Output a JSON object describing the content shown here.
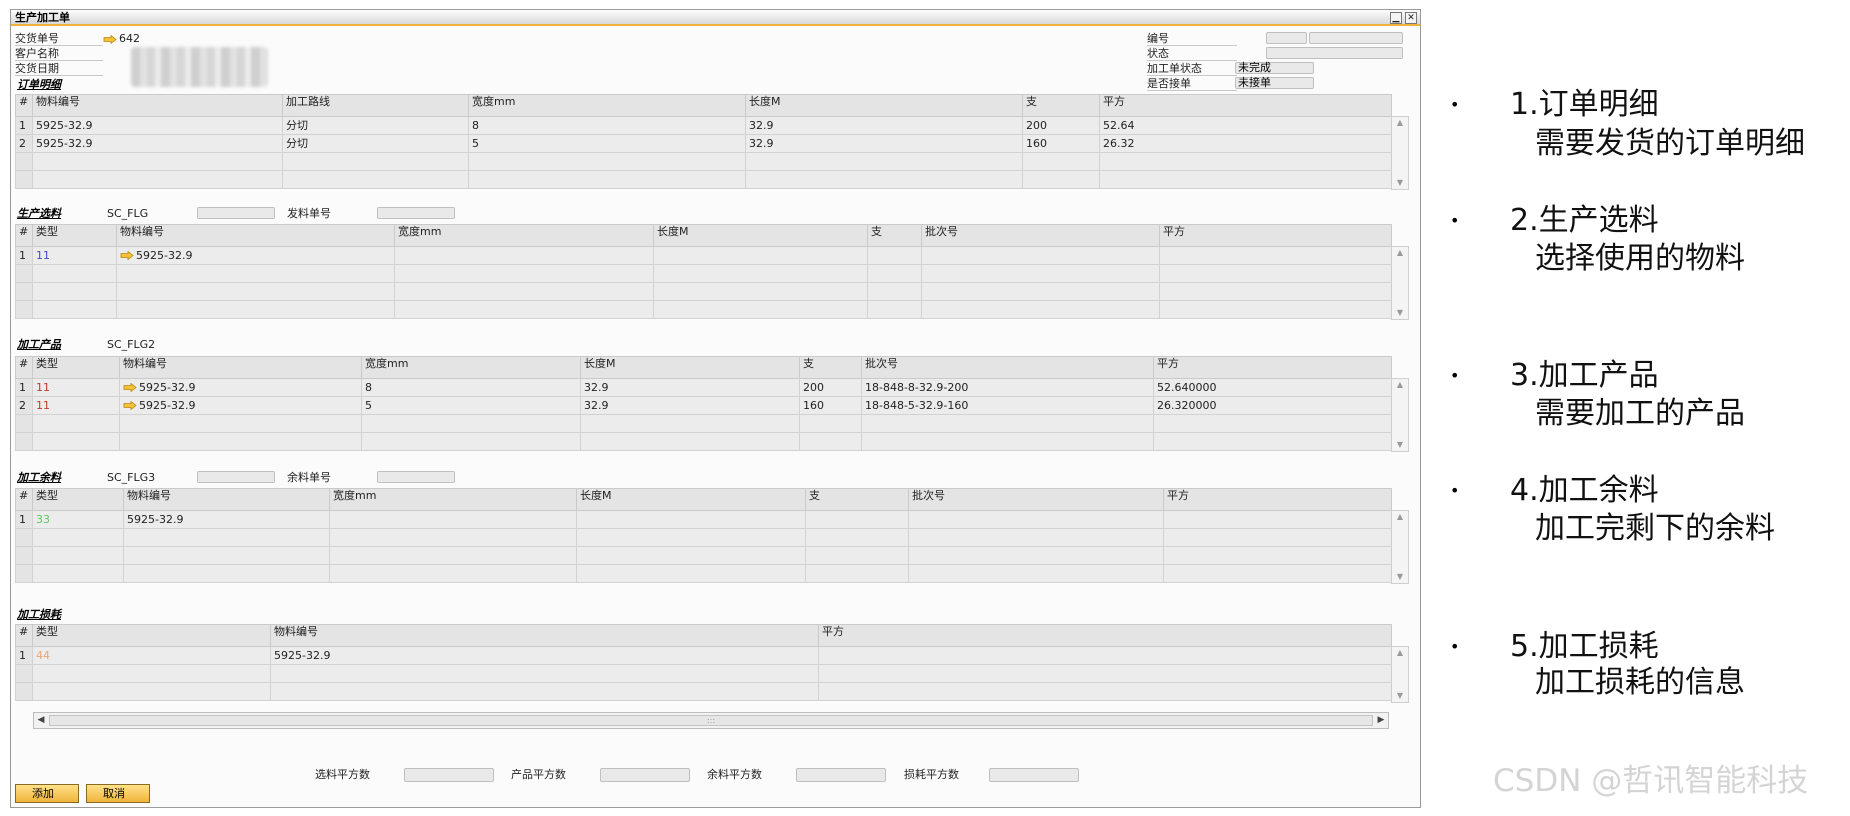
{
  "window": {
    "title": "生产加工单",
    "minimize_glyph": "▁",
    "close_glyph": "✕"
  },
  "header": {
    "delivery_no_label": "交货单号",
    "delivery_no_value": "642",
    "customer_label": "客户名称",
    "delivery_date_label": "交货日期",
    "code_label": "编号",
    "status_label": "状态",
    "process_status_label": "加工单状态",
    "process_status_value": "未完成",
    "is_accepted_label": "是否接单",
    "is_accepted_value": "未接单"
  },
  "order_detail": {
    "title": "订单明细",
    "headers": [
      "#",
      "物料编号",
      "加工路线",
      "宽度mm",
      "长度M",
      "支",
      "平方"
    ],
    "rows": [
      [
        "1",
        "5925-32.9",
        "分切",
        "8",
        "32.9",
        "200",
        "52.64"
      ],
      [
        "2",
        "5925-32.9",
        "分切",
        "5",
        "32.9",
        "160",
        "26.32"
      ]
    ]
  },
  "material_select": {
    "title": "生产选料",
    "flag": "SC_FLG",
    "issue_no_label": "发料单号",
    "headers": [
      "#",
      "类型",
      "物料编号",
      "宽度mm",
      "长度M",
      "支",
      "批次号",
      "平方"
    ],
    "rows": [
      [
        "1",
        "11",
        "5925-32.9",
        "",
        "",
        "",
        "",
        ""
      ]
    ]
  },
  "process_product": {
    "title": "加工产品",
    "flag": "SC_FLG2",
    "headers": [
      "#",
      "类型",
      "物料编号",
      "宽度mm",
      "长度M",
      "支",
      "批次号",
      "平方"
    ],
    "rows": [
      [
        "1",
        "11",
        "5925-32.9",
        "8",
        "32.9",
        "200",
        "18-848-8-32.9-200",
        "52.640000"
      ],
      [
        "2",
        "11",
        "5925-32.9",
        "5",
        "32.9",
        "160",
        "18-848-5-32.9-160",
        "26.320000"
      ]
    ]
  },
  "process_remainder": {
    "title": "加工余料",
    "flag": "SC_FLG3",
    "remainder_no_label": "余料单号",
    "headers": [
      "#",
      "类型",
      "物料编号",
      "宽度mm",
      "长度M",
      "支",
      "批次号",
      "平方"
    ],
    "rows": [
      [
        "1",
        "33",
        "5925-32.9",
        "",
        "",
        "",
        "",
        ""
      ]
    ]
  },
  "process_loss": {
    "title": "加工损耗",
    "headers": [
      "#",
      "类型",
      "物料编号",
      "平方"
    ],
    "rows": [
      [
        "1",
        "44",
        "5925-32.9",
        ""
      ]
    ]
  },
  "footer": {
    "select_sqm_label": "选料平方数",
    "product_sqm_label": "产品平方数",
    "remainder_sqm_label": "余料平方数",
    "loss_sqm_label": "损耗平方数",
    "add_button": "添加",
    "cancel_button": "取消"
  },
  "annotations": [
    {
      "title": "1.订单明细",
      "desc": "需要发货的订单明细"
    },
    {
      "title": "2.生产选料",
      "desc": "选择使用的物料"
    },
    {
      "title": "3.加工产品",
      "desc": "需要加工的产品"
    },
    {
      "title": "4.加工余料",
      "desc": "加工完剩下的余料"
    },
    {
      "title": "5.加工损耗",
      "desc": "加工损耗的信息"
    }
  ],
  "bullet_glyph": "•",
  "watermark": "CSDN @哲讯智能科技",
  "colors": {
    "accent": "#f2b33a",
    "type_11": "#3a4bd0",
    "type_11_product": "#c0392b",
    "type_33": "#5ec85e",
    "type_44": "#e8a77a"
  }
}
